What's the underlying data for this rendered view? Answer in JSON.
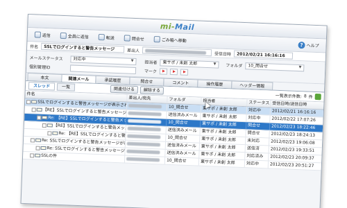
{
  "app": {
    "logo_prefix": "mi-",
    "logo_main": "Mail"
  },
  "toolbar": {
    "reply": "返信",
    "reply_all": "全員に返信",
    "forward": "転送",
    "question": "問合せ",
    "trash": "ごみ箱へ移動",
    "help": "ヘルプ",
    "icons": [
      "reply-icon",
      "reply-all-icon",
      "forward-icon",
      "inquiry-icon",
      "trash-icon",
      "help-icon"
    ]
  },
  "message": {
    "subject_label": "件名",
    "subject": "SSLでログインすると警告メッセージ",
    "sender_label": "差出人",
    "received_label": "受信日時",
    "received": "2012/02/21 16:16:16"
  },
  "fields": {
    "status_label": "メールステータス",
    "status_value": "対応中",
    "owner_label": "担当者",
    "owner_value": "東サポ / 未創 太郎",
    "folder_label": "フォルダ",
    "folder_value": "10_問合せ",
    "manage_id_label": "個別管理ID",
    "mark_label": "マーク"
  },
  "tabs": [
    "本文",
    "関連メール",
    "承認履歴",
    "問合せ",
    "コメント",
    "操作履歴",
    "ヘッダー情報"
  ],
  "active_tab": 1,
  "subtabs": [
    "スレッド",
    "一覧"
  ],
  "actions": {
    "open_related": "関連付ける",
    "release": "解除する"
  },
  "count": {
    "label": "一覧表示件数:",
    "value": "8",
    "unit": "件"
  },
  "grid": {
    "headers": [
      "件名",
      "差出人/宛先",
      "フォルダ",
      "担当者",
      "ステータス",
      "受信日時/送信日時"
    ],
    "rows": [
      {
        "subject": "SSLでログインすると警告メッセージが表示され…",
        "folder": "10_問合せ",
        "owner": "東サポ / 未創 太郎",
        "status": "対応中",
        "date": "2012/02/21 16:16:16",
        "indent": 0,
        "style": "hl"
      },
      {
        "subject": "【RE】SSLでログインすると警告メッセージが…",
        "folder": "送信済みメール",
        "owner": "東サポ / 未創 太郎",
        "status": "対応中",
        "date": "2012/02/22 17:07:26",
        "indent": 1,
        "style": ""
      },
      {
        "subject": "Re: 【RE】SSLでログインすると警告メッ…",
        "folder": "10_問合せ",
        "owner": "東サポ / 未創 太郎",
        "status": "問合せ",
        "date": "2012/02/23 18:22:46",
        "indent": 2,
        "style": "sel2"
      },
      {
        "subject": "【RE】SSLでログインすると警告メッ…",
        "folder": "送信済みメール",
        "owner": "東サポ / 未創 太郎",
        "status": "問合せ",
        "date": "2012/02/23 18:24:13",
        "indent": 3,
        "style": ""
      },
      {
        "subject": "Re: 【RE】SSLでログインすると警告メッ…",
        "folder": "10_問合せ",
        "owner": "東サポ / 未創 太郎",
        "status": "未対応",
        "date": "2012/02/23 19:06:08",
        "indent": 4,
        "style": ""
      },
      {
        "subject": "Re: SSLでログインすると警告メッセージが表…",
        "folder": "送信済みメール",
        "owner": "東サポ / 未創 太郎",
        "status": "送信済",
        "date": "2012/02/23 19:33:51",
        "indent": 1,
        "style": ""
      },
      {
        "subject": "Re: SSLでログインすると警告メッセージ…",
        "folder": "送信済みメール",
        "owner": "東サポ / 未創 太郎",
        "status": "対応済み",
        "date": "2012/02/23 20:09:37",
        "indent": 2,
        "style": ""
      },
      {
        "subject": "SSLの件",
        "folder": "10_問合せ",
        "owner": "東サポ / 未創 太郎",
        "status": "対応中",
        "date": "2012/02/23 20:51:27",
        "indent": 1,
        "style": ""
      }
    ]
  }
}
